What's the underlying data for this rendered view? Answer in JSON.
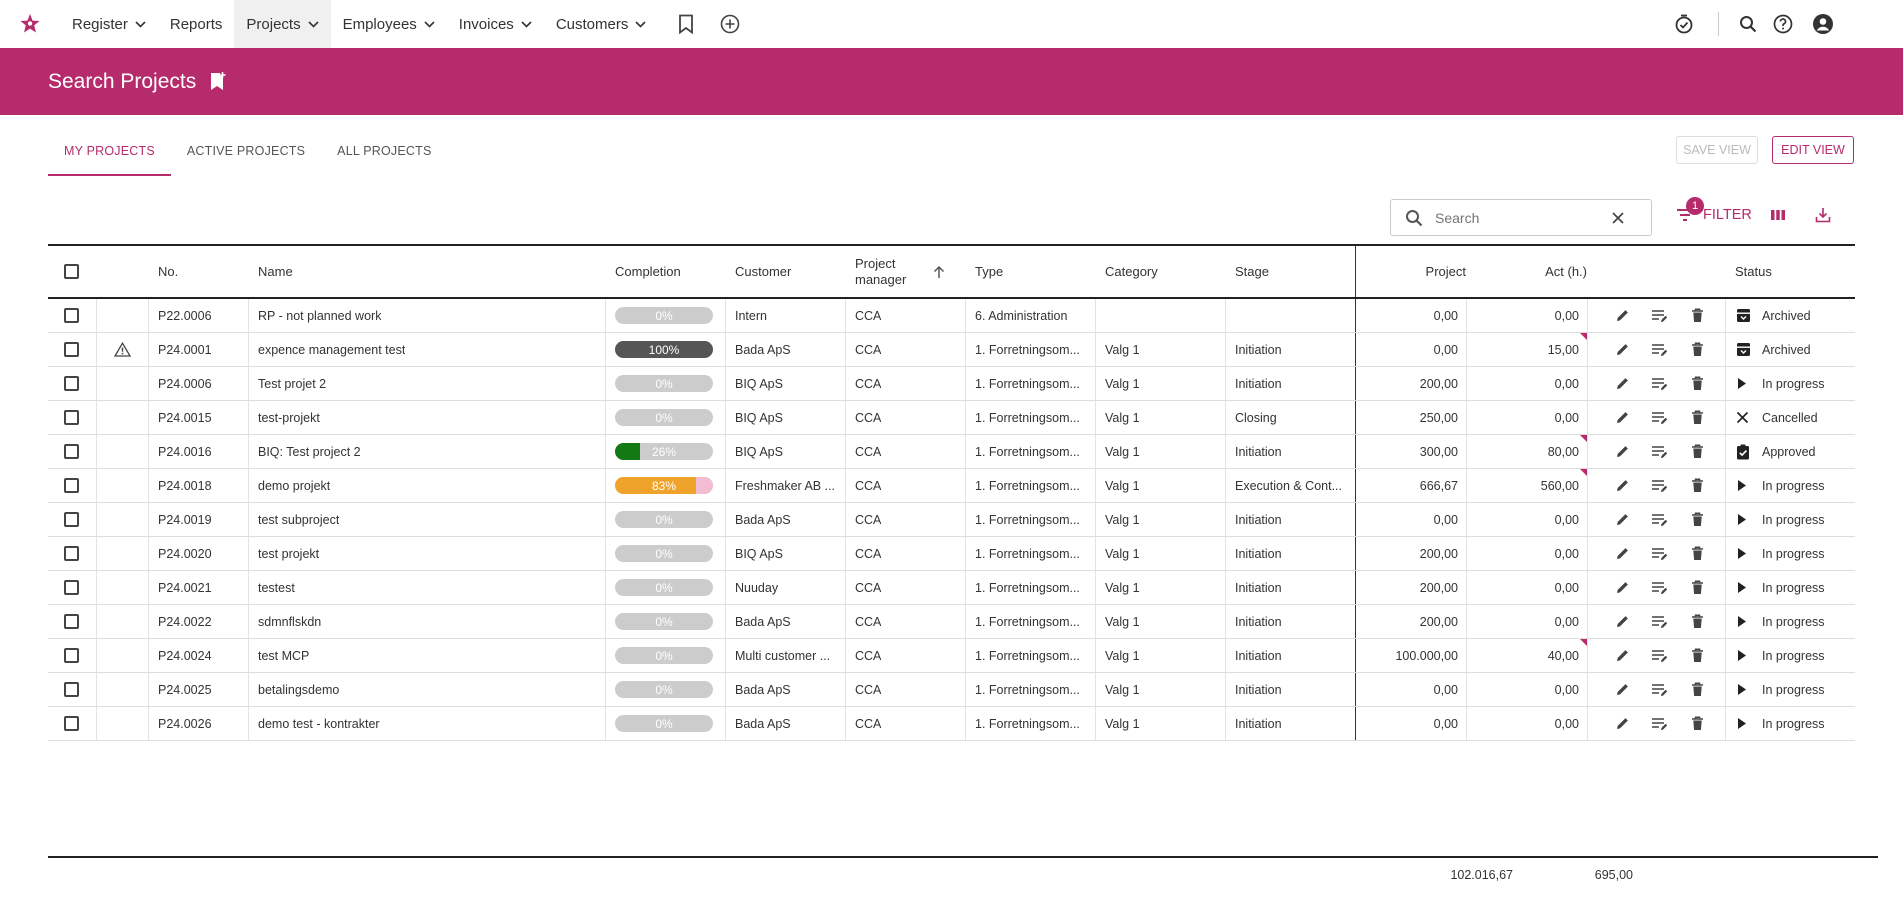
{
  "nav": {
    "items": [
      {
        "label": "Register",
        "chevron": true
      },
      {
        "label": "Reports",
        "chevron": false
      },
      {
        "label": "Projects",
        "chevron": true,
        "active": true
      },
      {
        "label": "Employees",
        "chevron": true
      },
      {
        "label": "Invoices",
        "chevron": true
      },
      {
        "label": "Customers",
        "chevron": true
      }
    ]
  },
  "banner": {
    "title": "Search Projects",
    "color": "#b52b6b"
  },
  "tabs": [
    "MY PROJECTS",
    "ACTIVE PROJECTS",
    "ALL PROJECTS"
  ],
  "actions": {
    "save_view": "SAVE VIEW",
    "edit_view": "EDIT VIEW"
  },
  "search": {
    "placeholder": "Search",
    "value": ""
  },
  "filter": {
    "label": "FILTER",
    "count": "1"
  },
  "columns": {
    "no": "No.",
    "name": "Name",
    "completion": "Completion",
    "customer": "Customer",
    "pm": "Project manager",
    "type": "Type",
    "category": "Category",
    "stage": "Stage",
    "project": "Project",
    "act": "Act (h.)",
    "status": "Status"
  },
  "rows": [
    {
      "no": "P22.0006",
      "warn": false,
      "name": "RP - not planned work",
      "completion": "0%",
      "fill": 0,
      "customer": "Intern",
      "pm": "CCA",
      "type": "6. Administration",
      "category": "",
      "stage": "",
      "project": "0,00",
      "act": "0,00",
      "act_flag": false,
      "status": "Archived",
      "status_icon": "archive-icon"
    },
    {
      "no": "P24.0001",
      "warn": true,
      "name": "expence management test",
      "completion": "100%",
      "fill": 100,
      "fill_color": "#555555",
      "customer": "Bada ApS",
      "pm": "CCA",
      "type": "1. Forretningsom...",
      "category": "Valg 1",
      "stage": "Initiation",
      "project": "0,00",
      "act": "15,00",
      "act_flag": true,
      "status": "Archived",
      "status_icon": "archive-icon"
    },
    {
      "no": "P24.0006",
      "warn": false,
      "name": "Test projet 2",
      "completion": "0%",
      "fill": 0,
      "customer": "BIQ ApS",
      "pm": "CCA",
      "type": "1. Forretningsom...",
      "category": "Valg 1",
      "stage": "Initiation",
      "project": "200,00",
      "act": "0,00",
      "act_flag": false,
      "status": "In progress",
      "status_icon": "play-icon"
    },
    {
      "no": "P24.0015",
      "warn": false,
      "name": "test-projekt",
      "completion": "0%",
      "fill": 0,
      "customer": "BIQ ApS",
      "pm": "CCA",
      "type": "1. Forretningsom...",
      "category": "Valg 1",
      "stage": "Closing",
      "project": "250,00",
      "act": "0,00",
      "act_flag": false,
      "status": "Cancelled",
      "status_icon": "x-icon"
    },
    {
      "no": "P24.0016",
      "warn": false,
      "name": "BIQ: Test project 2",
      "completion": "26%",
      "fill": 26,
      "fill_color": "#137a13",
      "customer": "BIQ ApS",
      "pm": "CCA",
      "type": "1. Forretningsom...",
      "category": "Valg 1",
      "stage": "Initiation",
      "project": "300,00",
      "act": "80,00",
      "act_flag": true,
      "status": "Approved",
      "status_icon": "check-clipboard-icon"
    },
    {
      "no": "P24.0018",
      "warn": false,
      "name": "demo projekt",
      "completion": "83%",
      "fill": 83,
      "fill_color": "#f0a32a",
      "customer": "Freshmaker AB ...",
      "pm": "CCA",
      "type": "1. Forretningsom...",
      "category": "Valg 1",
      "stage": "Execution & Cont...",
      "project": "666,67",
      "act": "560,00",
      "act_flag": true,
      "status": "In progress",
      "status_icon": "play-icon"
    },
    {
      "no": "P24.0019",
      "warn": false,
      "name": "test subproject",
      "completion": "0%",
      "fill": 0,
      "customer": "Bada ApS",
      "pm": "CCA",
      "type": "1. Forretningsom...",
      "category": "Valg 1",
      "stage": "Initiation",
      "project": "0,00",
      "act": "0,00",
      "act_flag": false,
      "status": "In progress",
      "status_icon": "play-icon"
    },
    {
      "no": "P24.0020",
      "warn": false,
      "name": "test projekt",
      "completion": "0%",
      "fill": 0,
      "customer": "BIQ ApS",
      "pm": "CCA",
      "type": "1. Forretningsom...",
      "category": "Valg 1",
      "stage": "Initiation",
      "project": "200,00",
      "act": "0,00",
      "act_flag": false,
      "status": "In progress",
      "status_icon": "play-icon"
    },
    {
      "no": "P24.0021",
      "warn": false,
      "name": "testest",
      "completion": "0%",
      "fill": 0,
      "customer": "Nuuday",
      "pm": "CCA",
      "type": "1. Forretningsom...",
      "category": "Valg 1",
      "stage": "Initiation",
      "project": "200,00",
      "act": "0,00",
      "act_flag": false,
      "status": "In progress",
      "status_icon": "play-icon"
    },
    {
      "no": "P24.0022",
      "warn": false,
      "name": "sdmnflskdn",
      "completion": "0%",
      "fill": 0,
      "customer": "Bada ApS",
      "pm": "CCA",
      "type": "1. Forretningsom...",
      "category": "Valg 1",
      "stage": "Initiation",
      "project": "200,00",
      "act": "0,00",
      "act_flag": false,
      "status": "In progress",
      "status_icon": "play-icon"
    },
    {
      "no": "P24.0024",
      "warn": false,
      "name": "test MCP",
      "completion": "0%",
      "fill": 0,
      "customer": "Multi customer ...",
      "pm": "CCA",
      "type": "1. Forretningsom...",
      "category": "Valg 1",
      "stage": "Initiation",
      "project": "100.000,00",
      "act": "40,00",
      "act_flag": true,
      "status": "In progress",
      "status_icon": "play-icon"
    },
    {
      "no": "P24.0025",
      "warn": false,
      "name": "betalingsdemo",
      "completion": "0%",
      "fill": 0,
      "customer": "Bada ApS",
      "pm": "CCA",
      "type": "1. Forretningsom...",
      "category": "Valg 1",
      "stage": "Initiation",
      "project": "0,00",
      "act": "0,00",
      "act_flag": false,
      "status": "In progress",
      "status_icon": "play-icon"
    },
    {
      "no": "P24.0026",
      "warn": false,
      "name": "demo test - kontrakter",
      "completion": "0%",
      "fill": 0,
      "customer": "Bada ApS",
      "pm": "CCA",
      "type": "1. Forretningsom...",
      "category": "Valg 1",
      "stage": "Initiation",
      "project": "0,00",
      "act": "0,00",
      "act_flag": false,
      "status": "In progress",
      "status_icon": "play-icon"
    }
  ],
  "totals": {
    "project": "102.016,67",
    "act": "695,00"
  }
}
